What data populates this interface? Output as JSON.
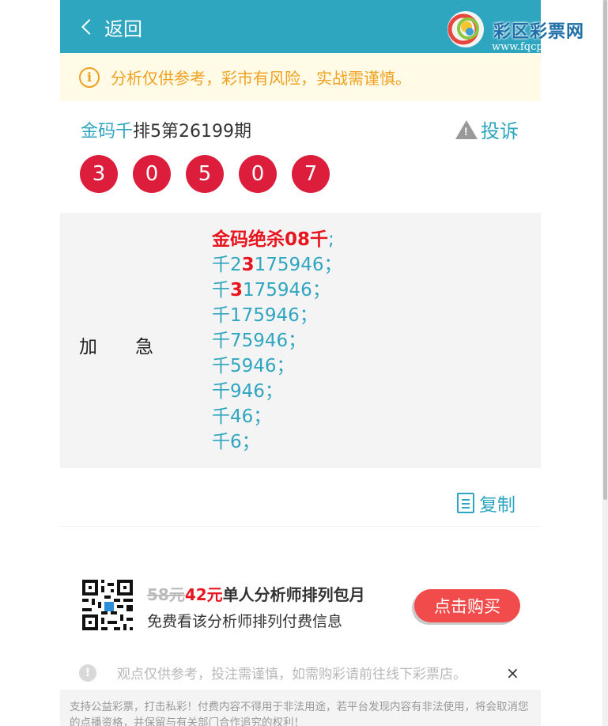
{
  "header": {
    "back_label": "返回",
    "brand": "彩区彩票网",
    "site": "www.fqcp.net"
  },
  "notice": {
    "text": "分析仅供参考，彩市有风险，实战需谨慎。"
  },
  "article": {
    "title_part1": "金码千",
    "title_part2": "排5第26199期",
    "complain_label": "投诉",
    "numbers": [
      "3",
      "0",
      "5",
      "0",
      "7"
    ]
  },
  "content": {
    "tag_a": "加",
    "tag_b": "急",
    "lines": [
      {
        "pre": "",
        "red": "金码绝杀08千",
        "post": ";"
      },
      {
        "pre": "千2",
        "red": "3",
        "post": "175946；"
      },
      {
        "pre": "千",
        "red": "3",
        "post": "175946；"
      },
      {
        "pre": "千175946；",
        "red": "",
        "post": ""
      },
      {
        "pre": "千75946；",
        "red": "",
        "post": ""
      },
      {
        "pre": "千5946；",
        "red": "",
        "post": ""
      },
      {
        "pre": "千946；",
        "red": "",
        "post": ""
      },
      {
        "pre": "千46；",
        "red": "",
        "post": ""
      },
      {
        "pre": "千6；",
        "red": "",
        "post": ""
      }
    ],
    "copy_label": "复制"
  },
  "promo": {
    "old_price": "58元",
    "new_price": "42元",
    "title_rest": "单人分析师排列包月",
    "subtitle": "免费看该分析师排列付费信息",
    "buy_label": "点击购买"
  },
  "disclaimer": {
    "text": "观点仅供参考，投注需谨慎，如需购彩请前往线下彩票店。",
    "close": "×"
  },
  "footer": {
    "text": "支持公益彩票，打击私彩！付费内容不得用于非法用途，若平台发现内容有非法使用，将会取消您的点播资格，并保留与有关部门合作追究的权利！"
  },
  "colors": {
    "header": "#2fa6c0",
    "accent": "#2fa6c0",
    "ball": "#dc1e3c",
    "buy": "#f24b4b",
    "warn": "#f0a020"
  }
}
